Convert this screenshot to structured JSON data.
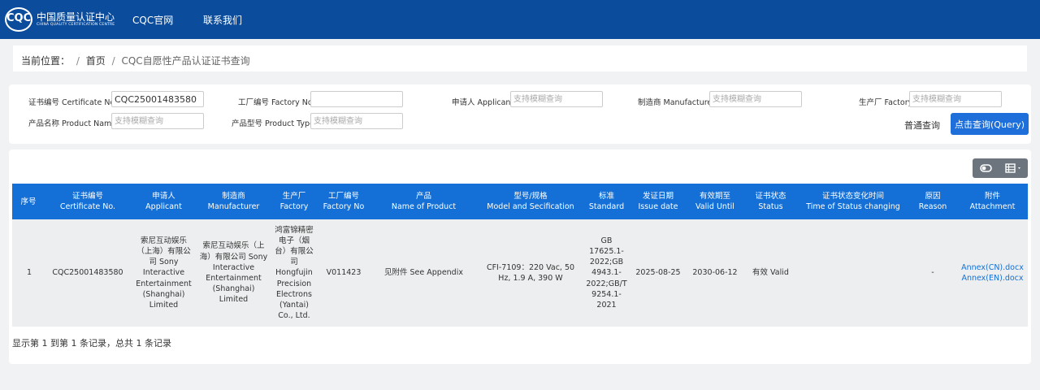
{
  "header": {
    "logo_mark": "CQC",
    "logo_cn": "中国质量认证中心",
    "logo_en": "CHINA QUALITY CERTIFICATION CENTRE",
    "nav": [
      "CQC官网",
      "联系我们"
    ]
  },
  "breadcrumb": {
    "prefix": "当前位置：",
    "sep": "/",
    "home": "首页",
    "current": "CQC自愿性产品认证证书查询"
  },
  "filters": {
    "certificate_no": {
      "label": "证书编号 Certificate No.:",
      "value": "CQC25001483580",
      "placeholder": ""
    },
    "factory_no": {
      "label": "工厂编号 Factory No.:",
      "value": "",
      "placeholder": ""
    },
    "applicant": {
      "label": "申请人 Applicant:",
      "value": "",
      "placeholder": "支持模糊查询"
    },
    "manufacturer": {
      "label": "制造商 Manufacturer:",
      "value": "",
      "placeholder": "支持模糊查询"
    },
    "factory": {
      "label": "生产厂 Factory:",
      "value": "",
      "placeholder": "支持模糊查询"
    },
    "product_name": {
      "label": "产品名称 Product Name:",
      "value": "",
      "placeholder": "支持模糊查询"
    },
    "product_type": {
      "label": "产品型号 Product Type:",
      "value": "",
      "placeholder": "支持模糊查询"
    },
    "plain_query_label": "普通查询",
    "query_label": "点击查询(Query)"
  },
  "toolbar": {
    "toggle_icon": "toggle-icon",
    "columns_icon": "columns-icon"
  },
  "table": {
    "headers": [
      {
        "cn": "序号",
        "en": ""
      },
      {
        "cn": "证书编号",
        "en": "Certificate No."
      },
      {
        "cn": "申请人",
        "en": "Applicant"
      },
      {
        "cn": "制造商",
        "en": "Manufacturer"
      },
      {
        "cn": "生产厂",
        "en": "Factory"
      },
      {
        "cn": "工厂编号",
        "en": "Factory No"
      },
      {
        "cn": "产品",
        "en": "Name of Product"
      },
      {
        "cn": "型号/规格",
        "en": "Model and Secification"
      },
      {
        "cn": "标准",
        "en": "Standard"
      },
      {
        "cn": "发证日期",
        "en": "Issue date"
      },
      {
        "cn": "有效期至",
        "en": "Valid Until"
      },
      {
        "cn": "证书状态",
        "en": "Status"
      },
      {
        "cn": "证书状态变化时间",
        "en": "Time of Status changing"
      },
      {
        "cn": "原因",
        "en": "Reason"
      },
      {
        "cn": "附件",
        "en": "Attachment"
      }
    ],
    "rows": [
      {
        "seq": "1",
        "certificate_no": "CQC25001483580",
        "applicant": "索尼互动娱乐（上海）有限公司 Sony Interactive Entertainment (Shanghai) Limited",
        "manufacturer": "索尼互动娱乐（上海）有限公司 Sony Interactive Entertainment (Shanghai) Limited",
        "factory": "鸿富锦精密电子（烟台）有限公司 Hongfujin Precision Electrons (Yantai) Co., Ltd.",
        "factory_no": "V011423",
        "product": "见附件 See Appendix",
        "model": "CFI-7109：220 Vac, 50 Hz, 1.9 A, 390 W",
        "standard": "GB 17625.1-2022;GB 4943.1-2022;GB/T 9254.1-2021",
        "issue_date": "2025-08-25",
        "valid_until": "2030-06-12",
        "status": "有效 Valid",
        "status_changed": "",
        "reason": "-",
        "attachments": [
          "Annex(CN).docx",
          "Annex(EN).docx"
        ]
      }
    ]
  },
  "footer": {
    "summary": "显示第 1 到第 1 条记录，总共 1 条记录"
  },
  "colors": {
    "header_bg": "#0b4d9c",
    "table_header_bg": "#1470d6",
    "primary_button": "#1e6fd9",
    "toolbar_button": "#6c757d"
  }
}
